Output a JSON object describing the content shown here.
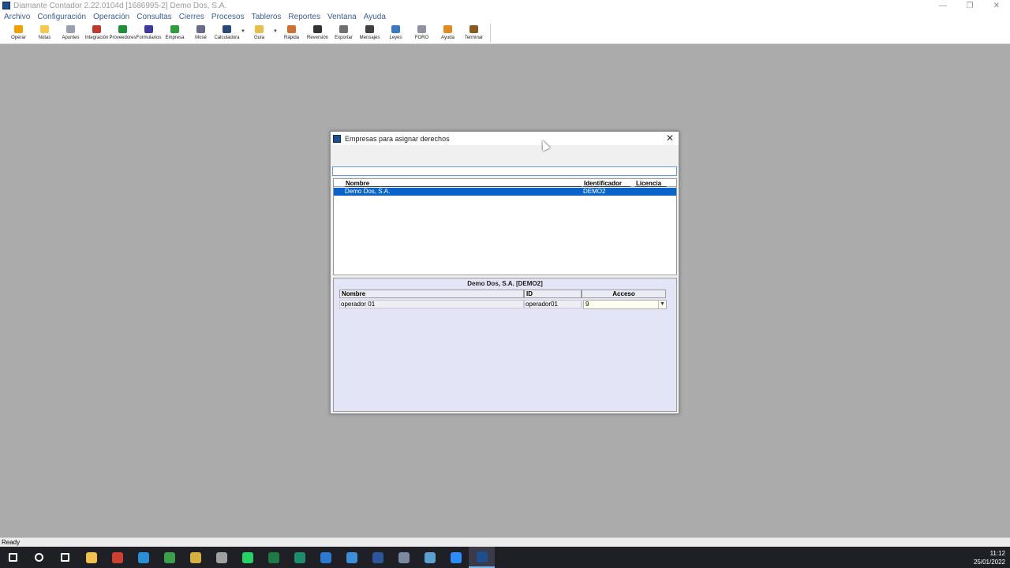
{
  "window": {
    "title": "Diamante Contador 2.22.0104d [1686995-2] Demo Dos, S.A.",
    "controls": [
      "—",
      "❐",
      "✕"
    ]
  },
  "menu": [
    "Archivo",
    "Configuración",
    "Operación",
    "Consultas",
    "Cierres",
    "Procesos",
    "Tableros",
    "Reportes",
    "Ventana",
    "Ayuda"
  ],
  "toolbar": [
    {
      "label": "Operar",
      "icon": "lightning-icon",
      "color": "#f0a000"
    },
    {
      "label": "Notas",
      "icon": "note-icon",
      "color": "#f5c84a"
    },
    {
      "label": "Apuntes",
      "icon": "notebook-icon",
      "color": "#9aa0b0"
    },
    {
      "label": "Integración",
      "icon": "gears-icon",
      "color": "#c0392b"
    },
    {
      "label": "Proveedores",
      "icon": "supplier-icon",
      "color": "#1e8f3a"
    },
    {
      "label": "Formularios",
      "icon": "grid-icon",
      "color": "#3a3aa0"
    },
    {
      "label": "Empresa",
      "icon": "refresh-icon",
      "color": "#2e9d3c"
    },
    {
      "label": "Mosé",
      "icon": "tree-icon",
      "color": "#6a6a8a"
    },
    {
      "label": "Calculadora",
      "icon": "calculator-icon",
      "color": "#2a4a7a"
    },
    {
      "label": "Guía",
      "icon": "chat-icon",
      "color": "#e6c04a"
    },
    {
      "label": "Rápida",
      "icon": "rocket-icon",
      "color": "#d07030"
    },
    {
      "label": "Reversión",
      "icon": "binoculars-icon",
      "color": "#333333"
    },
    {
      "label": "Exportar",
      "icon": "export-icon",
      "color": "#707070"
    },
    {
      "label": "Mensajes",
      "icon": "search-icon",
      "color": "#404040"
    },
    {
      "label": "Leyes",
      "icon": "scales-icon",
      "color": "#3a78c0"
    },
    {
      "label": "FORO",
      "icon": "forum-icon",
      "color": "#9090a0"
    },
    {
      "label": "Ayuda",
      "icon": "help-icon",
      "color": "#e08a20"
    },
    {
      "label": "Terminar",
      "icon": "exit-icon",
      "color": "#8a5a20"
    }
  ],
  "dialog": {
    "title": "Empresas para asignar derechos",
    "search_value": "",
    "list": {
      "columns": [
        "Nombre",
        "Identificador",
        "Licencia"
      ],
      "rows": [
        {
          "nombre": "Demo Dos, S.A.",
          "identificador": "DEMO2",
          "licencia": ""
        }
      ]
    },
    "detail": {
      "title": "Demo Dos, S.A. [DEMO2]",
      "columns": [
        "Nombre",
        "ID",
        "Acceso"
      ],
      "rows": [
        {
          "nombre": "operador 01",
          "id": "operador01",
          "acceso": "9"
        }
      ]
    }
  },
  "status": {
    "text": "Ready"
  },
  "taskbar": {
    "apps": [
      {
        "name": "start",
        "color": "#ffffff"
      },
      {
        "name": "search",
        "color": "#ffffff"
      },
      {
        "name": "task-view",
        "color": "#ffffff"
      },
      {
        "name": "file-explorer",
        "color": "#f2c04c"
      },
      {
        "name": "app-red",
        "color": "#d04030"
      },
      {
        "name": "edge",
        "color": "#2a8fd8"
      },
      {
        "name": "app-green",
        "color": "#3aa04a"
      },
      {
        "name": "app-yellow",
        "color": "#d8b040"
      },
      {
        "name": "app-gray",
        "color": "#a0a0a0"
      },
      {
        "name": "whatsapp",
        "color": "#25d366"
      },
      {
        "name": "excel",
        "color": "#1f7a43"
      },
      {
        "name": "app-e",
        "color": "#1c8c6c"
      },
      {
        "name": "app-vc",
        "color": "#2a7ad0"
      },
      {
        "name": "chrome",
        "color": "#3a8fd8"
      },
      {
        "name": "word",
        "color": "#2b579a"
      },
      {
        "name": "camera",
        "color": "#7a8aa0"
      },
      {
        "name": "notepad",
        "color": "#5aa0d0"
      },
      {
        "name": "zoom",
        "color": "#2d8cff"
      },
      {
        "name": "diamante",
        "color": "#1e4f8c"
      }
    ],
    "time": "11:12",
    "date": "25/01/2022"
  }
}
